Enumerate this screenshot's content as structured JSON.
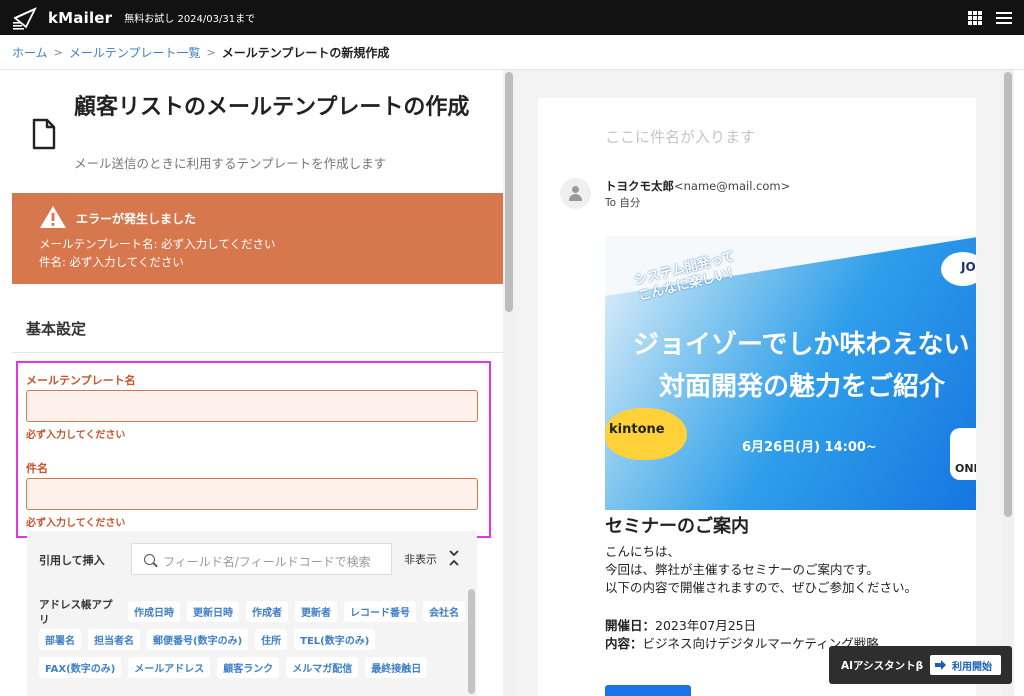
{
  "topbar": {
    "app_name": "kMailer",
    "trial_notice": "無料お試し 2024/03/31まで",
    "icons": [
      "kmailer-logo-icon",
      "apps-grid-icon",
      "hamburger-menu-icon"
    ]
  },
  "breadcrumb": {
    "home": "ホーム",
    "list": "メールテンプレート一覧",
    "current": "メールテンプレートの新規作成",
    "separator": ">"
  },
  "page": {
    "title": "顧客リストのメールテンプレートの作成",
    "subtitle": "メール送信のときに利用するテンプレートを作成します"
  },
  "error": {
    "title": "エラーが発生しました",
    "lines": [
      "メールテンプレート名: 必ず入力してください",
      "件名: 必ず入力してください"
    ],
    "color": "#d7774e"
  },
  "basic_settings": {
    "title": "基本設定",
    "template_name": {
      "label": "メールテンプレート名",
      "value": "",
      "error": "必ず入力してください"
    },
    "subject": {
      "label": "件名",
      "value": "",
      "error": "必ず入力してください"
    }
  },
  "insert": {
    "label": "引用して挿入",
    "search_placeholder": "フィールド名/フィールドコードで検索",
    "toggle_label": "非表示",
    "address_book_label": "アドレス帳アプリ",
    "tag_rows": [
      [
        "作成日時",
        "更新日時",
        "作成者",
        "更新者",
        "レコード番号",
        "会社名"
      ],
      [
        "部署名",
        "担当者名",
        "郵便番号(数字のみ)",
        "住所",
        "TEL(数字のみ)"
      ],
      [
        "FAX(数字のみ)",
        "メールアドレス",
        "顧客ランク",
        "メルマガ配信",
        "最終接触日"
      ]
    ]
  },
  "preview": {
    "subject_placeholder": "ここに件名が入ります",
    "sender_name": "トヨクモ太郎",
    "sender_email": "<name@mail.com>",
    "to": "To 自分",
    "banner": {
      "caption_line1": "システム開発って",
      "caption_line2": "こんなに楽しい！",
      "headline1": "ジョイゾーでしか味わえない",
      "headline2": "対面開発の魅力をご紹介",
      "badge": "kintone",
      "date": "6月26日(月) 14:00~",
      "logo_text": "JO",
      "corner_text": "ONL"
    },
    "heading": "セミナーのご案内",
    "body_lines": [
      "こんにちは、",
      "今回は、弊社が主催するセミナーのご案内です。",
      "以下の内容で開催されますので、ぜひご参加ください。"
    ],
    "date_label": "開催日：",
    "date_value": "2023年07月25日",
    "content_label": "内容：",
    "content_value": "ビジネス向けデジタルマーケティング戦略"
  },
  "ai_assistant": {
    "label": "AIアシスタントβ",
    "button": "利用開始"
  }
}
